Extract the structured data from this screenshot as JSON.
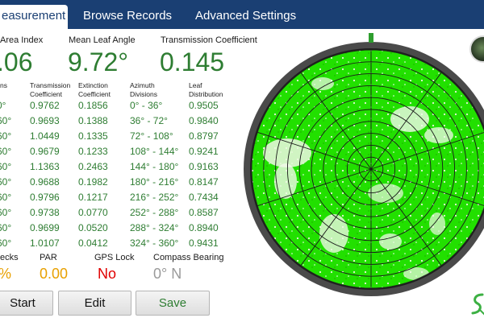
{
  "tabs": [
    {
      "label": "easurement"
    },
    {
      "label": "Browse Records"
    },
    {
      "label": "Advanced Settings"
    }
  ],
  "metrics": {
    "lai_label": "Area Index",
    "lai_value": ".06",
    "angle_label": "Mean Leaf Angle",
    "angle_value": "9.72°",
    "trans_label": "Transmission Coefficient",
    "trans_value": "0.145"
  },
  "table": {
    "headers": [
      "ns",
      "Transmission\nCoefficient",
      "Extinction\nCoefficient",
      "Azimuth\nDivisions",
      "Leaf\nDistribution"
    ],
    "rows": [
      [
        "0°",
        "0.9762",
        "0.1856",
        "0° - 36°",
        "0.9505"
      ],
      [
        "60°",
        "0.9693",
        "0.1388",
        "36° - 72°",
        "0.9840"
      ],
      [
        "60°",
        "1.0449",
        "0.1335",
        "72° - 108°",
        "0.8797"
      ],
      [
        "60°",
        "0.9679",
        "0.1233",
        "108° - 144°",
        "0.9241"
      ],
      [
        "60°",
        "1.1363",
        "0.2463",
        "144° - 180°",
        "0.9163"
      ],
      [
        "60°",
        "0.9688",
        "0.1982",
        "180° - 216°",
        "0.8147"
      ],
      [
        "60°",
        "0.9796",
        "0.1217",
        "216° - 252°",
        "0.7434"
      ],
      [
        "60°",
        "0.9738",
        "0.0770",
        "252° - 288°",
        "0.8587"
      ],
      [
        "60°",
        "0.9699",
        "0.0520",
        "288° - 324°",
        "0.8940"
      ],
      [
        "60°",
        "1.0107",
        "0.0412",
        "324° - 360°",
        "0.9431"
      ]
    ]
  },
  "status": {
    "flecks_label": "ecks",
    "flecks_value": "%",
    "par_label": "PAR",
    "par_value": "0.00",
    "gps_label": "GPS Lock",
    "gps_value": "No",
    "compass_label": "Compass Bearing",
    "compass_value": "0° N"
  },
  "buttons": {
    "start": "Start",
    "edit": "Edit",
    "save": "Save"
  },
  "icons": {
    "thumbnail": "canopy-thumbnail-icon",
    "logo": "brand-logo-icon"
  },
  "colors": {
    "tab_bar": "#1a3f73",
    "value_green": "#2e7d32",
    "canopy_green": "#22e000",
    "par_orange": "#e8a000",
    "gps_red": "#e00000",
    "compass_gray": "#9a9a9a"
  }
}
